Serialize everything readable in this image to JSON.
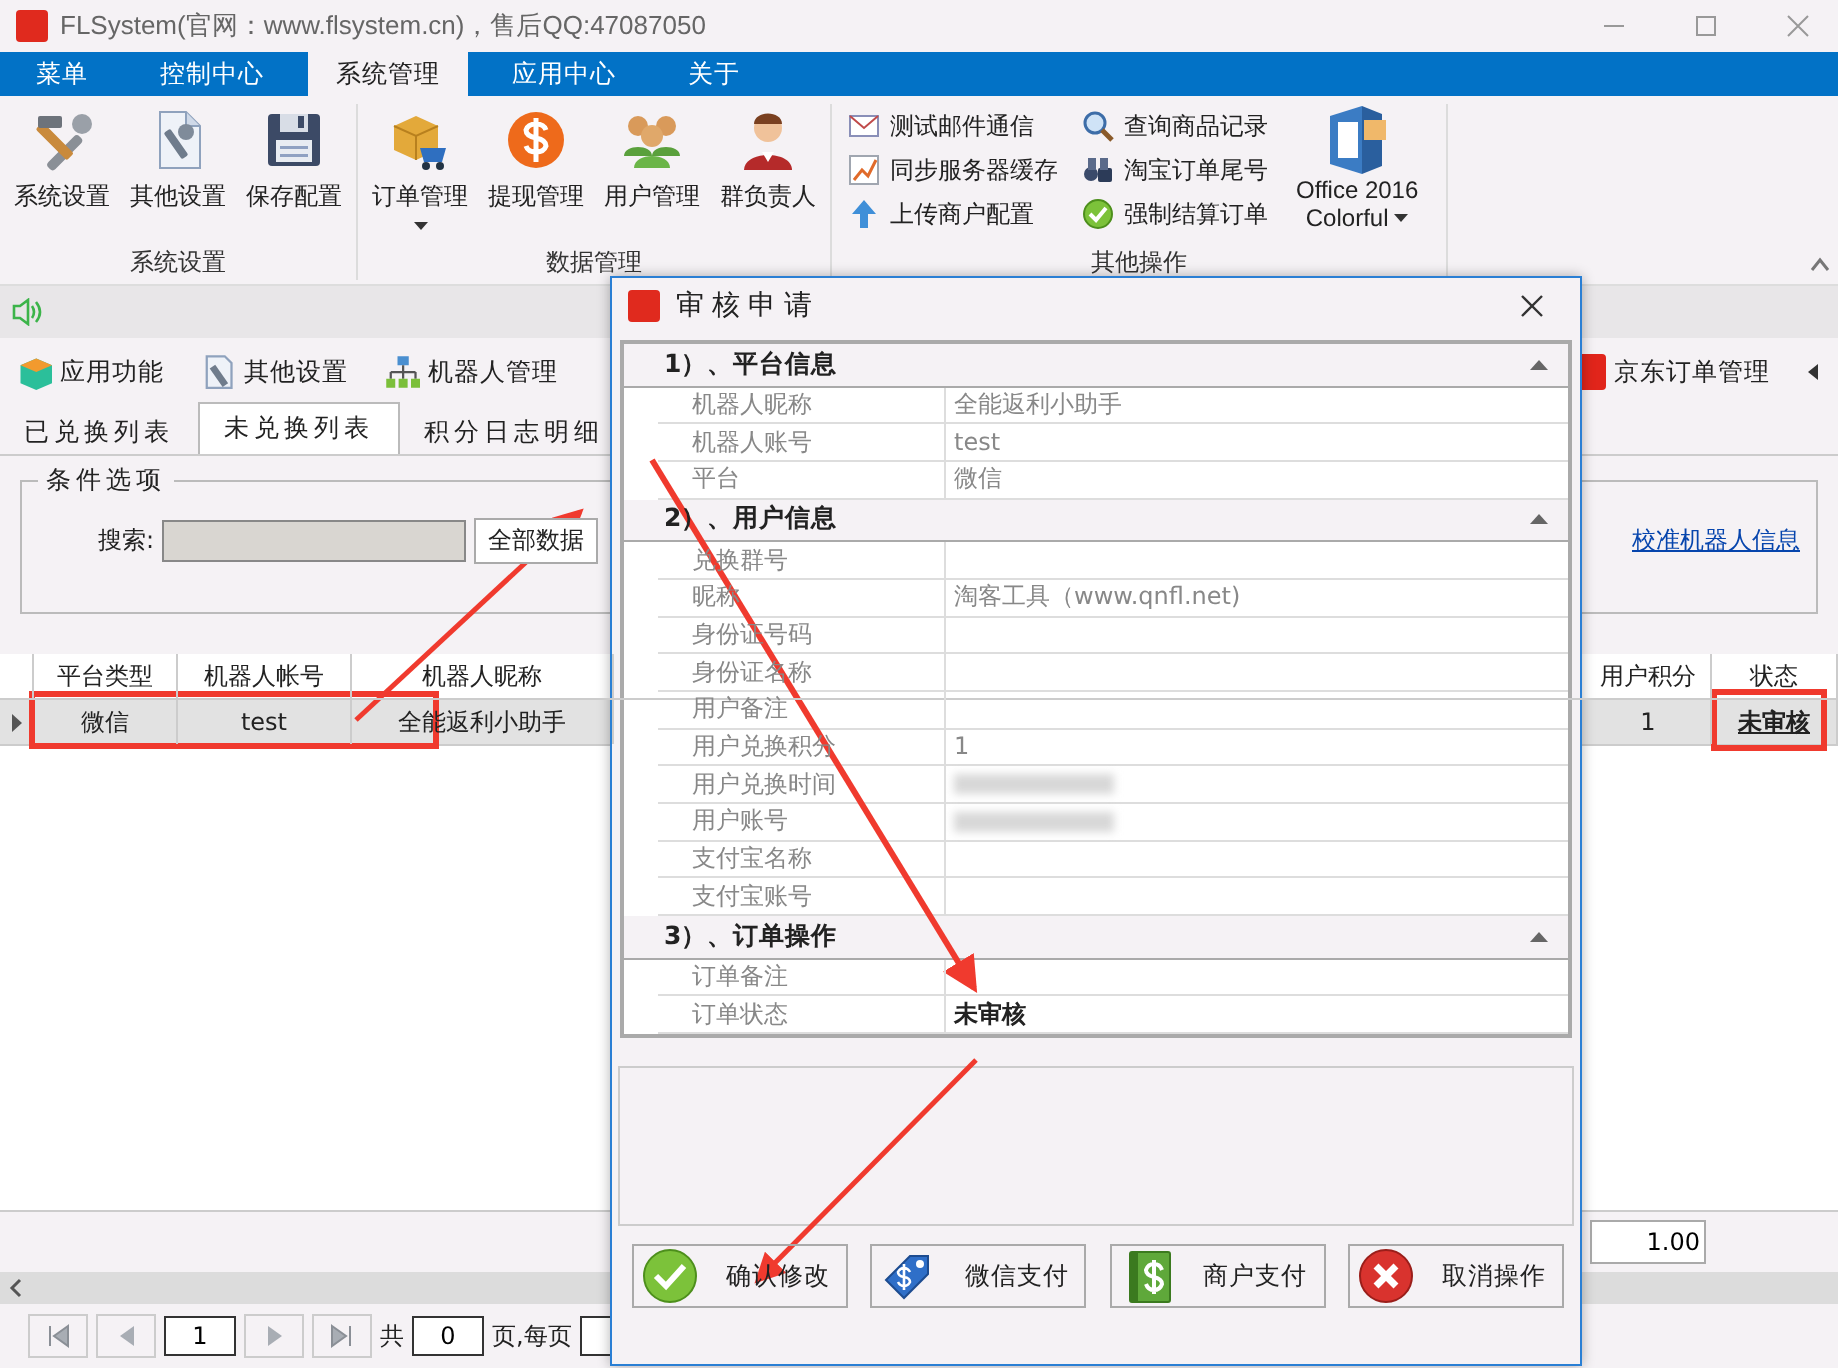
{
  "window": {
    "title": "FLSystem(官网：www.flsystem.cn)，售后QQ:47087050"
  },
  "menu_tabs": [
    {
      "label": "菜单",
      "selected": false
    },
    {
      "label": "控制中心",
      "selected": false
    },
    {
      "label": "系统管理",
      "selected": true
    },
    {
      "label": "应用中心",
      "selected": false
    },
    {
      "label": "关于",
      "selected": false
    }
  ],
  "ribbon_groups": [
    {
      "label": "系统设置",
      "kind": "large",
      "items": [
        {
          "label": "系统设置",
          "dropdown": false
        },
        {
          "label": "其他设置",
          "dropdown": false
        },
        {
          "label": "保存配置",
          "dropdown": false
        }
      ]
    },
    {
      "label": "数据管理",
      "kind": "large",
      "items": [
        {
          "label": "订单管理",
          "dropdown": true
        },
        {
          "label": "提现管理",
          "dropdown": false
        },
        {
          "label": "用户管理",
          "dropdown": false
        },
        {
          "label": "群负责人",
          "dropdown": false
        }
      ]
    },
    {
      "label": "其他操作",
      "kind": "small",
      "items": [
        {
          "label": "测试邮件通信"
        },
        {
          "label": "同步服务器缓存"
        },
        {
          "label": "上传商户配置"
        },
        {
          "label": "查询商品记录"
        },
        {
          "label": "淘宝订单尾号"
        },
        {
          "label": "强制结算订单"
        }
      ],
      "theme": {
        "line1": "Office 2016",
        "line2": "Colorful"
      }
    }
  ],
  "toolbar": {
    "items": [
      "应用功能",
      "其他设置",
      "机器人管理"
    ],
    "right_item": "京东订单管理"
  },
  "sub_tabs": [
    {
      "label": "已兑换列表",
      "selected": false
    },
    {
      "label": "未兑换列表",
      "selected": true
    },
    {
      "label": "积分日志明细",
      "selected": false
    }
  ],
  "filter": {
    "legend": "条件选项",
    "search_label": "搜索:",
    "all_button": "全部数据",
    "link": "校准机器人信息"
  },
  "table": {
    "columns": [
      "平台类型",
      "机器人帐号",
      "机器人昵称",
      "用户积分",
      "状态"
    ],
    "rows": [
      {
        "cells": [
          "微信",
          "test",
          "全能返利小助手",
          "1",
          "未审核"
        ],
        "selected": true
      }
    ]
  },
  "total_field": "1.00",
  "pager": {
    "page": "1",
    "total_prefix": "共",
    "total": "0",
    "per_page_label": "页,每页"
  },
  "dialog": {
    "title": "审核申请",
    "sections": [
      {
        "title": "1）、平台信息",
        "expanded": true,
        "rows": [
          {
            "label": "机器人昵称",
            "value": "全能返利小助手"
          },
          {
            "label": "机器人账号",
            "value": "test"
          },
          {
            "label": "平台",
            "value": "微信"
          }
        ]
      },
      {
        "title": "2）、用户信息",
        "expanded": true,
        "rows": [
          {
            "label": "兑换群号"
          },
          {
            "label": "昵称",
            "value": "淘客工具（www.qnfl.net)"
          },
          {
            "label": "身份证号码"
          },
          {
            "label": "身份证名称"
          },
          {
            "label": "用户备注"
          },
          {
            "label": "用户兑换积分",
            "value": "1"
          },
          {
            "label": "用户兑换时间",
            "blurred": true
          },
          {
            "label": "用户账号",
            "blurred": true
          },
          {
            "label": "支付宝名称"
          },
          {
            "label": "支付宝账号"
          }
        ]
      },
      {
        "title": "3）、订单操作",
        "expanded": true,
        "rows": [
          {
            "label": "订单备注"
          },
          {
            "label": "订单状态",
            "value": "未审核",
            "emphasis": true
          }
        ]
      }
    ],
    "buttons": [
      "确认修改",
      "微信支付",
      "商户支付",
      "取消操作"
    ]
  }
}
